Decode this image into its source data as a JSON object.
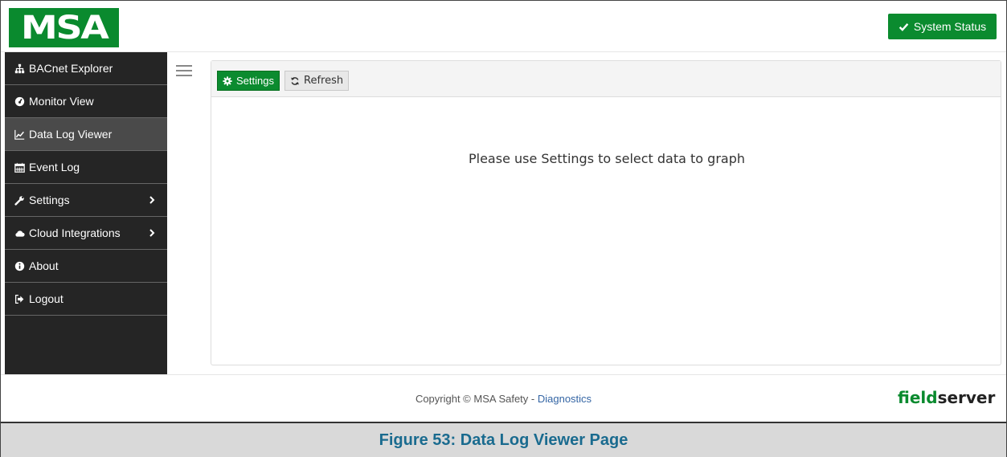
{
  "brand": {
    "logo_text": "MSA",
    "color": "#0a8a2e"
  },
  "header": {
    "status_label": "System Status"
  },
  "sidebar": {
    "items": [
      {
        "label": "BACnet Explorer",
        "icon": "sitemap-icon",
        "active": false,
        "has_submenu": false
      },
      {
        "label": "Monitor View",
        "icon": "dashboard-icon",
        "active": false,
        "has_submenu": false
      },
      {
        "label": "Data Log Viewer",
        "icon": "line-chart-icon",
        "active": true,
        "has_submenu": false
      },
      {
        "label": "Event Log",
        "icon": "calendar-icon",
        "active": false,
        "has_submenu": false
      },
      {
        "label": "Settings",
        "icon": "wrench-icon",
        "active": false,
        "has_submenu": true
      },
      {
        "label": "Cloud Integrations",
        "icon": "cloud-icon",
        "active": false,
        "has_submenu": true
      },
      {
        "label": "About",
        "icon": "info-icon",
        "active": false,
        "has_submenu": false
      },
      {
        "label": "Logout",
        "icon": "sign-out-icon",
        "active": false,
        "has_submenu": false
      }
    ]
  },
  "panel": {
    "settings_label": "Settings",
    "refresh_label": "Refresh",
    "message": "Please use Settings to select data to graph"
  },
  "footer": {
    "copyright": "Copyright © MSA Safety - ",
    "link_label": "Diagnostics",
    "fs_logo_part1": "field",
    "fs_logo_part2": "server"
  },
  "caption": {
    "text": "Figure 53: Data Log Viewer Page"
  }
}
